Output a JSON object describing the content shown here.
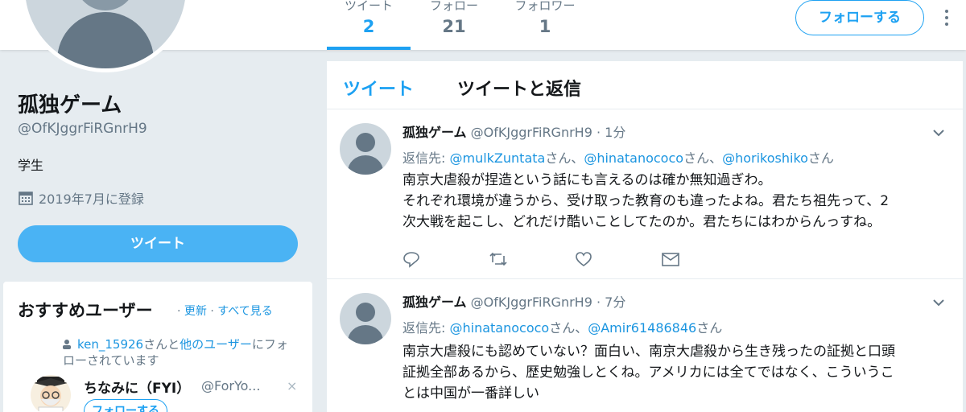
{
  "nav": {
    "stats": [
      {
        "label": "ツイート",
        "value": "2"
      },
      {
        "label": "フォロー",
        "value": "21"
      },
      {
        "label": "フォロワー",
        "value": "1"
      }
    ],
    "follow_label": "フォローする"
  },
  "profile": {
    "name": "孤独ゲーム",
    "handle": "@OfKJggrFiRGnrH9",
    "bio": "学生",
    "joined": "2019年7月に登録",
    "tweet_button": "ツイート"
  },
  "who_to_follow": {
    "title": "おすすめユーザー",
    "sep1": " · ",
    "refresh": "更新",
    "sep2": " · ",
    "view_all": "すべて見る",
    "social_user": "ken_15926",
    "social_mid": "さんと",
    "social_others": "他のユーザー",
    "social_end": "にフォローされています",
    "user_name": "ちなみに（FYI）",
    "user_handle": "@ForYo...",
    "close": "×",
    "follow_label": "フォローする"
  },
  "timeline": {
    "tabs": [
      "ツイート",
      "ツイートと返信"
    ],
    "tweets": [
      {
        "name": "孤独ゲーム",
        "handle": "@OfKJggrFiRGnrH9",
        "time": "· 1分",
        "reply_prefix": "返信先: ",
        "reply_to": [
          "@mulkZuntata",
          "@hinatanococo",
          "@horikoshiko"
        ],
        "reply_suffix": "さん",
        "reply_sep": "さん、",
        "lines": [
          "南京大虐殺が捏造という話にも言えるのは確か無知過ぎわ。",
          "それぞれ環境が違うから、受け取った教育のも違ったよね。君たち祖先って、2",
          "次大戦を起こし、どれだけ酷いことしてたのか。君たちにはわからんっすね。"
        ]
      },
      {
        "name": "孤独ゲーム",
        "handle": "@OfKJggrFiRGnrH9",
        "time": "· 7分",
        "reply_prefix": "返信先: ",
        "reply_to": [
          "@hinatanococo",
          "@Amir61486846"
        ],
        "reply_suffix": "さん",
        "reply_sep": "さん、",
        "lines": [
          "南京大虐殺にも認めていない？面白い、南京大虐殺から生き残ったの証拠と口頭",
          "証拠全部あるから、歴史勉強しとくね。アメリカには全てではなく、こういうこ",
          "とは中国が一番詳しい"
        ]
      }
    ]
  }
}
